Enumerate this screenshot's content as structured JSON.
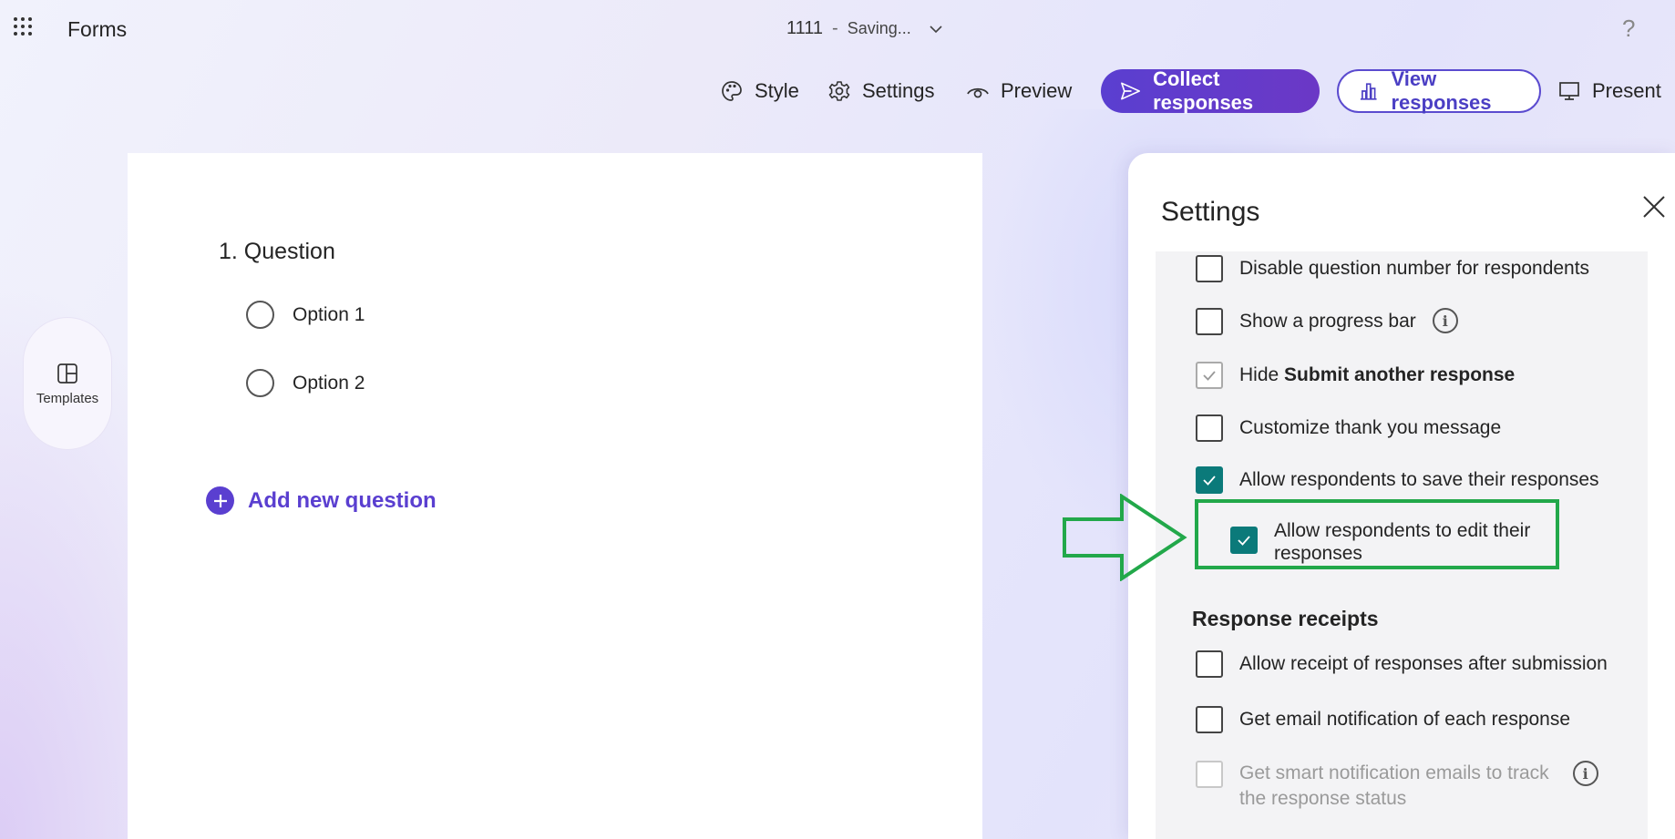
{
  "app": {
    "name": "Forms"
  },
  "doc": {
    "title": "1111",
    "separator": "-",
    "status": "Saving..."
  },
  "help": {
    "label": "?"
  },
  "toolbar": {
    "style": "Style",
    "settings": "Settings",
    "preview": "Preview",
    "collect": "Collect responses",
    "view": "View responses",
    "present": "Present"
  },
  "templates": {
    "label": "Templates"
  },
  "form": {
    "question": "1. Question",
    "options": [
      "Option 1",
      "Option 2"
    ],
    "add_question": "Add new question"
  },
  "settings": {
    "title": "Settings",
    "items": [
      {
        "label": "Disable question number for respondents",
        "checked": false
      },
      {
        "label": "Show a progress bar",
        "checked": false
      },
      {
        "label_prefix": "Hide ",
        "label_bold": "Submit another response",
        "checked": true,
        "disabled": true
      },
      {
        "label": "Customize thank you message",
        "checked": false
      },
      {
        "label": "Allow respondents to save their responses",
        "checked": true
      },
      {
        "label_line1": "Allow respondents to edit their",
        "label_line2": "responses",
        "checked": true
      }
    ],
    "receipts_heading": "Response receipts",
    "receipts": [
      {
        "label": "Allow receipt of responses after submission",
        "checked": false
      },
      {
        "label": "Get email notification of each response",
        "checked": false
      },
      {
        "label_line1": "Get smart notification emails to track",
        "label_line2": "the response status",
        "checked": false,
        "disabled": true
      }
    ]
  },
  "colors": {
    "accent": "#5a3fd0",
    "checkbox_checked": "#0b7a7a",
    "annotation_green": "#22a84a"
  }
}
